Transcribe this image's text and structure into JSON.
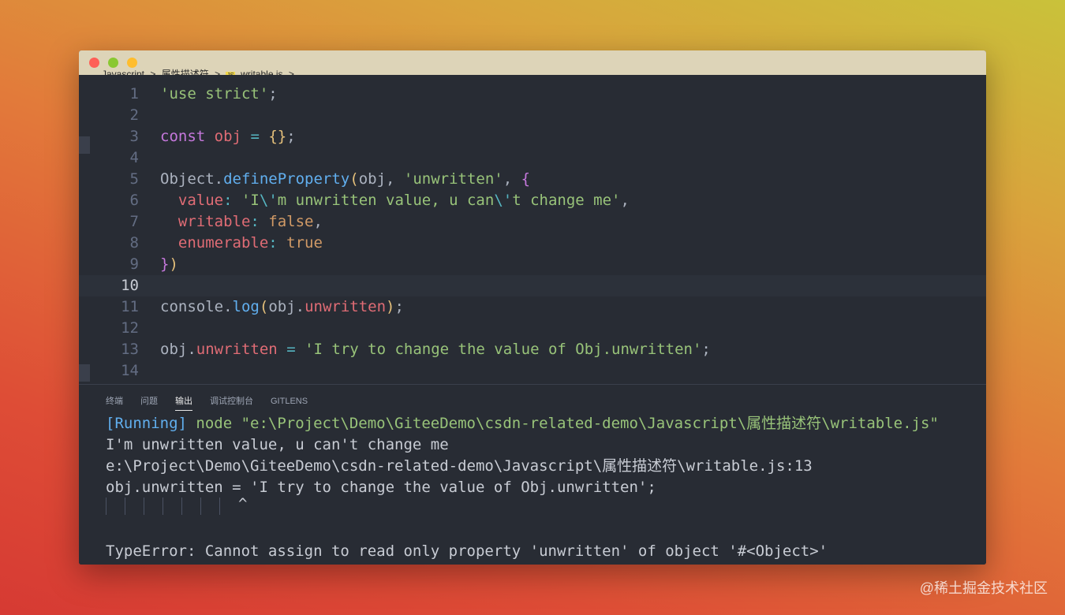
{
  "window": {
    "breadcrumb": [
      "Javascript",
      ">",
      "属性描述符",
      ">",
      "JS",
      "writable.js",
      ">",
      "..."
    ]
  },
  "editor": {
    "lines": [
      {
        "num": "1",
        "tokens": [
          {
            "t": "'use strict'",
            "c": "str"
          },
          {
            "t": ";",
            "c": "plain"
          }
        ]
      },
      {
        "num": "2",
        "tokens": []
      },
      {
        "num": "3",
        "tokens": [
          {
            "t": "const",
            "c": "kw"
          },
          {
            "t": " ",
            "c": "plain"
          },
          {
            "t": "obj",
            "c": "var"
          },
          {
            "t": " ",
            "c": "plain"
          },
          {
            "t": "=",
            "c": "op"
          },
          {
            "t": " ",
            "c": "plain"
          },
          {
            "t": "{}",
            "c": "br1"
          },
          {
            "t": ";",
            "c": "plain"
          }
        ]
      },
      {
        "num": "4",
        "tokens": []
      },
      {
        "num": "5",
        "tokens": [
          {
            "t": "Object",
            "c": "plain"
          },
          {
            "t": ".",
            "c": "plain"
          },
          {
            "t": "defineProperty",
            "c": "fn"
          },
          {
            "t": "(",
            "c": "br1"
          },
          {
            "t": "obj, ",
            "c": "plain"
          },
          {
            "t": "'unwritten'",
            "c": "str"
          },
          {
            "t": ", ",
            "c": "plain"
          },
          {
            "t": "{",
            "c": "br2"
          }
        ]
      },
      {
        "num": "6",
        "tokens": [
          {
            "t": "  ",
            "c": "plain"
          },
          {
            "t": "value",
            "c": "var"
          },
          {
            "t": ": ",
            "c": "op"
          },
          {
            "t": "'I",
            "c": "str"
          },
          {
            "t": "\\'",
            "c": "esc"
          },
          {
            "t": "m unwritten value, u can",
            "c": "str"
          },
          {
            "t": "\\'",
            "c": "esc"
          },
          {
            "t": "t change me'",
            "c": "str"
          },
          {
            "t": ",",
            "c": "plain"
          }
        ]
      },
      {
        "num": "7",
        "tokens": [
          {
            "t": "  ",
            "c": "plain"
          },
          {
            "t": "writable",
            "c": "var"
          },
          {
            "t": ": ",
            "c": "op"
          },
          {
            "t": "false",
            "c": "bool"
          },
          {
            "t": ",",
            "c": "plain"
          }
        ]
      },
      {
        "num": "8",
        "tokens": [
          {
            "t": "  ",
            "c": "plain"
          },
          {
            "t": "enumerable",
            "c": "var"
          },
          {
            "t": ": ",
            "c": "op"
          },
          {
            "t": "true",
            "c": "bool"
          }
        ]
      },
      {
        "num": "9",
        "tokens": [
          {
            "t": "}",
            "c": "br2"
          },
          {
            "t": ")",
            "c": "br1"
          }
        ]
      },
      {
        "num": "10",
        "tokens": [],
        "active": true
      },
      {
        "num": "11",
        "tokens": [
          {
            "t": "console",
            "c": "plain"
          },
          {
            "t": ".",
            "c": "plain"
          },
          {
            "t": "log",
            "c": "fn"
          },
          {
            "t": "(",
            "c": "br1"
          },
          {
            "t": "obj",
            "c": "plain"
          },
          {
            "t": ".",
            "c": "plain"
          },
          {
            "t": "unwritten",
            "c": "var"
          },
          {
            "t": ")",
            "c": "br1"
          },
          {
            "t": ";",
            "c": "plain"
          }
        ]
      },
      {
        "num": "12",
        "tokens": []
      },
      {
        "num": "13",
        "tokens": [
          {
            "t": "obj",
            "c": "plain"
          },
          {
            "t": ".",
            "c": "plain"
          },
          {
            "t": "unwritten",
            "c": "var"
          },
          {
            "t": " ",
            "c": "plain"
          },
          {
            "t": "=",
            "c": "op"
          },
          {
            "t": " ",
            "c": "plain"
          },
          {
            "t": "'I try to change the value of Obj.unwritten'",
            "c": "str"
          },
          {
            "t": ";",
            "c": "plain"
          }
        ]
      },
      {
        "num": "14",
        "tokens": []
      }
    ]
  },
  "panel": {
    "tabs": [
      {
        "label": "终端",
        "active": false
      },
      {
        "label": "问题",
        "active": false
      },
      {
        "label": "输出",
        "active": true
      },
      {
        "label": "调试控制台",
        "active": false
      },
      {
        "label": "GITLENS",
        "active": false
      }
    ],
    "output": {
      "running_tag": "[Running]",
      "running_cmd": " node \"e:\\Project\\Demo\\GiteeDemo\\csdn-related-demo\\Javascript\\属性描述符\\writable.js\"",
      "line2": "I'm unwritten value, u can't change me",
      "line3": "e:\\Project\\Demo\\GiteeDemo\\csdn-related-demo\\Javascript\\属性描述符\\writable.js:13",
      "line4": "obj.unwritten = 'I try to change the value of Obj.unwritten';",
      "caret": "^",
      "error": "TypeError: Cannot assign to read only property 'unwritten' of object '#<Object>'"
    }
  },
  "watermark": "@稀土掘金技术社区"
}
